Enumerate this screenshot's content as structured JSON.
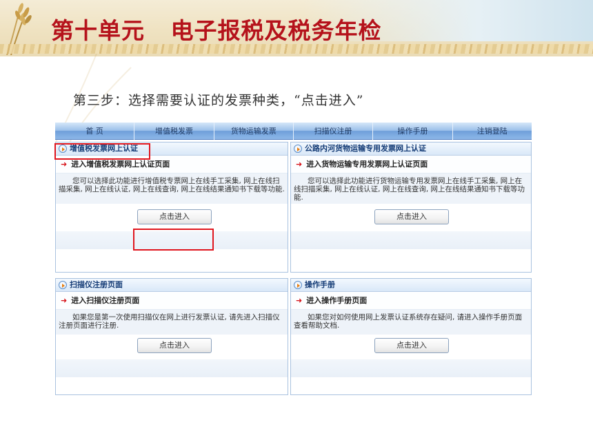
{
  "slide": {
    "title": "第十单元   电子报税及税务年检",
    "step_text": "第三步：选择需要认证的发票种类，“点击进入”"
  },
  "nav": {
    "items": [
      "首  页",
      "增值税发票",
      "货物运输发票",
      "扫描仪注册",
      "操作手册",
      "注销登陆"
    ]
  },
  "panels": [
    {
      "header": "增值税发票网上认证",
      "sub": "进入增值税发票网上认证页面",
      "desc": "您可以选择此功能进行增值税专票网上在线手工采集, 网上在线扫描采集, 网上在线认证, 网上在线查询, 网上在线结果通知书下载等功能.",
      "button": "点击进入"
    },
    {
      "header": "公路内河货物运输专用发票网上认证",
      "sub": "进入货物运输专用发票网上认证页面",
      "desc": "您可以选择此功能进行货物运输专用发票网上在线手工采集, 网上在线扫描采集, 网上在线认证, 网上在线查询, 网上在线结果通知书下载等功能.",
      "button": "点击进入"
    },
    {
      "header": "扫描仪注册页面",
      "sub": "进入扫描仪注册页面",
      "desc": "如果您是第一次使用扫描仪在网上进行发票认证, 请先进入扫描仪注册页面进行注册.",
      "button": "点击进入"
    },
    {
      "header": "操作手册",
      "sub": "进入操作手册页面",
      "desc": "如果您对如何使用网上发票认证系统存在疑问, 请进入操作手册页面查看帮助文档.",
      "button": "点击进入"
    }
  ],
  "colors": {
    "title_red": "#b5121b",
    "highlight_red": "#e0151d",
    "nav_blue": "#8db7e8",
    "header_text": "#123a75"
  }
}
